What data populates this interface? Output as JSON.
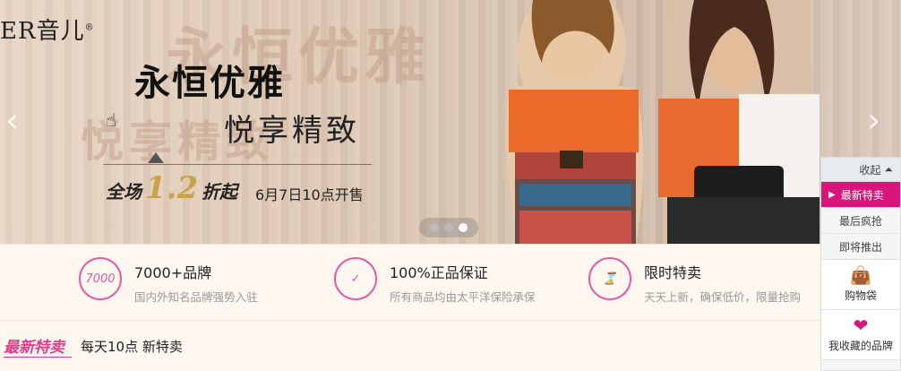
{
  "banner": {
    "brand_prefix": "ER",
    "brand_cn": "音儿",
    "brand_reg": "®",
    "title": "永恒优雅",
    "subtitle": "悦享精致",
    "ghost_title": "永恒优雅",
    "ghost_subtitle": "悦享精致",
    "promo_prefix": "全场",
    "promo_discount": "1.2",
    "promo_suffix": "折起",
    "date": "6月7日10点开售",
    "prev_arrow": "‹",
    "next_arrow": "›",
    "slide_count": 3,
    "active_slide": 3
  },
  "features": [
    {
      "icon_text": "7000",
      "title": "7000+品牌",
      "desc": "国内外知名品牌强势入驻"
    },
    {
      "icon_text": "✓",
      "title": "100%正品保证",
      "desc": "所有商品均由太平洋保险承保"
    },
    {
      "icon_text": "⌛",
      "title": "限时特卖",
      "desc": "天天上新，确保低价，限量抢购"
    }
  ],
  "section": {
    "tag": "最新特卖",
    "desc": "每天10点  新特卖"
  },
  "side_panel": {
    "collapse_label": "收起",
    "collapse_icon": "⏶",
    "items": [
      {
        "label": "最新特卖",
        "active": true
      },
      {
        "label": "最后疯抢",
        "active": false
      },
      {
        "label": "即将推出",
        "active": false
      }
    ],
    "cart_label": "购物袋",
    "fav_label": "我收藏的品牌",
    "accent_color": "#d9157c"
  }
}
